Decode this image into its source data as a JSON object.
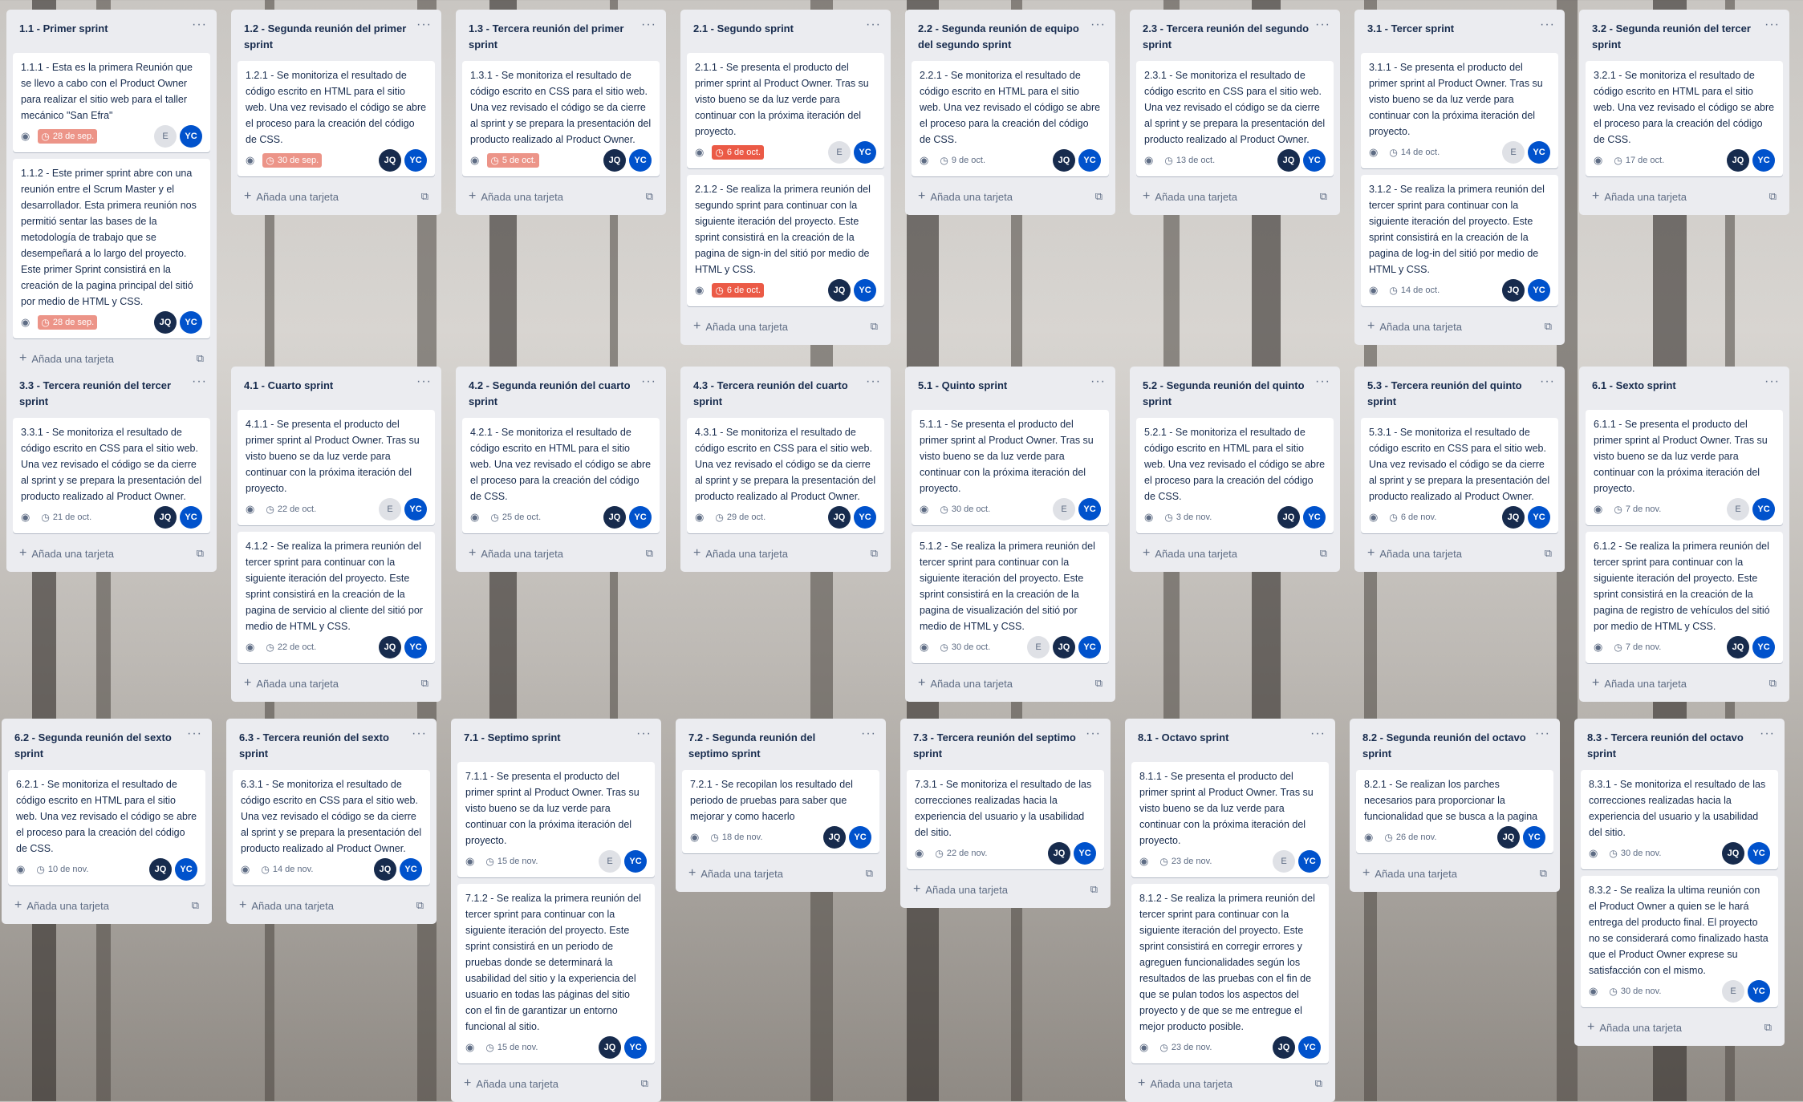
{
  "lists": [
    {
      "title": "1.1 - Primer sprint",
      "cards": [
        {
          "text": "1.1.1 - Esta es la primera Reunión que se llevo a cabo con el Product Owner para realizar el sitio web para el taller mecánico \"San Efra\"",
          "due": "28 de sep.",
          "due_status": "overdue-light",
          "members": [
            "E",
            "YC"
          ]
        },
        {
          "text": "1.1.2 - Este primer sprint abre con una reunión entre el Scrum Master y el desarrollador. Esta primera reunión nos permitió sentar las bases de la metodología de trabajo que se desempeñará a lo largo del proyecto. Este primer Sprint consistirá en la creación de la pagina principal del sitió por medio de HTML y CSS.",
          "due": "28 de sep.",
          "due_status": "overdue-light",
          "members": [
            "JQ",
            "YC"
          ]
        }
      ]
    },
    {
      "title": "1.2 - Segunda reunión del primer sprint",
      "cards": [
        {
          "text": "1.2.1 - Se monitoriza el resultado de código escrito en HTML para el sitio web. Una vez revisado el código se abre el proceso para la creación del código de CSS.",
          "due": "30 de sep.",
          "due_status": "overdue-light",
          "members": [
            "JQ",
            "YC"
          ]
        }
      ]
    },
    {
      "title": "1.3 - Tercera reunión del primer sprint",
      "cards": [
        {
          "text": "1.3.1 - Se monitoriza el resultado de código escrito en CSS para el sitio web. Una vez revisado el código se da cierre al sprint y se prepara la presentación del producto realizado al Product Owner.",
          "due": "5 de oct.",
          "due_status": "overdue-light",
          "members": [
            "JQ",
            "YC"
          ]
        }
      ]
    },
    {
      "title": "2.1 - Segundo sprint",
      "cards": [
        {
          "text": "2.1.1 - Se presenta el producto del primer sprint al Product Owner. Tras su visto bueno se da luz verde para continuar con la próxima iteración del proyecto.",
          "due": "6 de oct.",
          "due_status": "overdue",
          "members": [
            "E",
            "YC"
          ]
        },
        {
          "text": "2.1.2 - Se realiza la primera reunión del segundo sprint para continuar con la siguiente iteración del proyecto. Este sprint consistirá en la creación de la pagina de sign-in del sitió por medio de HTML y CSS.",
          "due": "6 de oct.",
          "due_status": "overdue",
          "members": [
            "JQ",
            "YC"
          ]
        }
      ]
    },
    {
      "title": "2.2 - Segunda reunión de equipo del segundo sprint",
      "cards": [
        {
          "text": "2.2.1 - Se monitoriza el resultado de código escrito en HTML para el sitio web. Una vez revisado el código se abre el proceso para la creación del código de CSS.",
          "due": "9 de oct.",
          "due_status": "",
          "members": [
            "JQ",
            "YC"
          ]
        }
      ]
    },
    {
      "title": "2.3 - Tercera reunión del segundo sprint",
      "cards": [
        {
          "text": "2.3.1 - Se monitoriza el resultado de código escrito en CSS para el sitio web. Una vez revisado el código se da cierre al sprint y se prepara la presentación del producto realizado al Product Owner.",
          "due": "13 de oct.",
          "due_status": "",
          "members": [
            "JQ",
            "YC"
          ]
        }
      ]
    },
    {
      "title": "3.1 - Tercer sprint",
      "cards": [
        {
          "text": "3.1.1 - Se presenta el producto del primer sprint al Product Owner. Tras su visto bueno se da luz verde para continuar con la próxima iteración del proyecto.",
          "due": "14 de oct.",
          "due_status": "",
          "members": [
            "E",
            "YC"
          ]
        },
        {
          "text": "3.1.2 - Se realiza la primera reunión del tercer sprint para continuar con la siguiente iteración del proyecto. Este sprint consistirá en la creación de la pagina de log-in del sitió por medio de HTML y CSS.",
          "due": "14 de oct.",
          "due_status": "",
          "members": [
            "JQ",
            "YC"
          ]
        }
      ]
    },
    {
      "title": "3.2 - Segunda reunión del tercer sprint",
      "cards": [
        {
          "text": "3.2.1 - Se monitoriza el resultado de código escrito en HTML para el sitio web. Una vez revisado el código se abre el proceso para la creación del código de CSS.",
          "due": "17 de oct.",
          "due_status": "",
          "members": [
            "JQ",
            "YC"
          ]
        }
      ]
    },
    {
      "title": "3.3 - Tercera reunión del tercer sprint",
      "cards": [
        {
          "text": "3.3.1 - Se monitoriza el resultado de código escrito en CSS para el sitio web. Una vez revisado el código se da cierre al sprint y se prepara la presentación del producto realizado al Product Owner.",
          "due": "21 de oct.",
          "due_status": "",
          "members": [
            "JQ",
            "YC"
          ]
        }
      ]
    },
    {
      "title": "4.1 - Cuarto sprint",
      "cards": [
        {
          "text": "4.1.1 - Se presenta el producto del primer sprint al Product Owner. Tras su visto bueno se da luz verde para continuar con la próxima iteración del proyecto.",
          "due": "22 de oct.",
          "due_status": "",
          "members": [
            "E",
            "YC"
          ]
        },
        {
          "text": "4.1.2 - Se realiza la primera reunión del tercer sprint para continuar con la siguiente iteración del proyecto. Este sprint consistirá en la creación de la pagina de servicio al cliente del sitió por medio de HTML y CSS.",
          "due": "22 de oct.",
          "due_status": "",
          "members": [
            "JQ",
            "YC"
          ]
        }
      ]
    },
    {
      "title": "4.2 - Segunda reunión del cuarto sprint",
      "cards": [
        {
          "text": "4.2.1 - Se monitoriza el resultado de código escrito en HTML para el sitio web. Una vez revisado el código se abre el proceso para la creación del código de CSS.",
          "due": "25 de oct.",
          "due_status": "",
          "members": [
            "JQ",
            "YC"
          ]
        }
      ]
    },
    {
      "title": "4.3 - Tercera reunión del cuarto sprint",
      "cards": [
        {
          "text": "4.3.1 - Se monitoriza el resultado de código escrito en CSS para el sitio web. Una vez revisado el código se da cierre al sprint y se prepara la presentación del producto realizado al Product Owner.",
          "due": "29 de oct.",
          "due_status": "",
          "members": [
            "JQ",
            "YC"
          ]
        }
      ]
    },
    {
      "title": "5.1 - Quinto sprint",
      "cards": [
        {
          "text": "5.1.1 - Se presenta el producto del primer sprint al Product Owner. Tras su visto bueno se da luz verde para continuar con la próxima iteración del proyecto.",
          "due": "30 de oct.",
          "due_status": "",
          "members": [
            "E",
            "YC"
          ]
        },
        {
          "text": "5.1.2 - Se realiza la primera reunión del tercer sprint para continuar con la siguiente iteración del proyecto. Este sprint consistirá en la creación de la pagina de visualización del sitió por medio de HTML y CSS.",
          "due": "30 de oct.",
          "due_status": "",
          "members": [
            "E",
            "JQ",
            "YC"
          ]
        }
      ]
    },
    {
      "title": "5.2 - Segunda reunión del quinto sprint",
      "cards": [
        {
          "text": "5.2.1 - Se monitoriza el resultado de código escrito en HTML para el sitio web. Una vez revisado el código se abre el proceso para la creación del código de CSS.",
          "due": "3 de nov.",
          "due_status": "",
          "members": [
            "JQ",
            "YC"
          ]
        }
      ]
    },
    {
      "title": "5.3 - Tercera reunión del quinto sprint",
      "cards": [
        {
          "text": "5.3.1 - Se monitoriza el resultado de código escrito en CSS para el sitio web. Una vez revisado el código se da cierre al sprint y se prepara la presentación del producto realizado al Product Owner.",
          "due": "6 de nov.",
          "due_status": "",
          "members": [
            "JQ",
            "YC"
          ]
        }
      ]
    },
    {
      "title": "6.1 - Sexto sprint",
      "cards": [
        {
          "text": "6.1.1 - Se presenta el producto del primer sprint al Product Owner. Tras su visto bueno se da luz verde para continuar con la próxima iteración del proyecto.",
          "due": "7 de nov.",
          "due_status": "",
          "members": [
            "E",
            "YC"
          ]
        },
        {
          "text": "6.1.2 - Se realiza la primera reunión del tercer sprint para continuar con la siguiente iteración del proyecto. Este sprint consistirá en la creación de la pagina de registro de vehículos del sitió por medio de HTML y CSS.",
          "due": "7 de nov.",
          "due_status": "",
          "members": [
            "JQ",
            "YC"
          ]
        }
      ]
    },
    {
      "title": "6.2 - Segunda reunión del sexto sprint",
      "cards": [
        {
          "text": "6.2.1 - Se monitoriza el resultado de código escrito en HTML para el sitio web. Una vez revisado el código se abre el proceso para la creación del código de CSS.",
          "due": "10 de nov.",
          "due_status": "",
          "members": [
            "JQ",
            "YC"
          ]
        }
      ]
    },
    {
      "title": "6.3 - Tercera reunión del sexto sprint",
      "cards": [
        {
          "text": "6.3.1 - Se monitoriza el resultado de código escrito en CSS para el sitio web. Una vez revisado el código se da cierre al sprint y se prepara la presentación del producto realizado al Product Owner.",
          "due": "14 de nov.",
          "due_status": "",
          "members": [
            "JQ",
            "YC"
          ]
        }
      ]
    },
    {
      "title": "7.1 - Septimo sprint",
      "cards": [
        {
          "text": "7.1.1 - Se presenta el producto del primer sprint al Product Owner. Tras su visto bueno se da luz verde para continuar con la próxima iteración del proyecto.",
          "due": "15 de nov.",
          "due_status": "",
          "members": [
            "E",
            "YC"
          ]
        },
        {
          "text": "7.1.2 - Se realiza la primera reunión del tercer sprint para continuar con la siguiente iteración del proyecto. Este sprint consistirá en un periodo de pruebas donde se determinará la usabilidad del sitio y la experiencia del usuario en todas las páginas del sitio con el fin de garantizar un entorno funcional al sitio.",
          "due": "15 de nov.",
          "due_status": "",
          "members": [
            "JQ",
            "YC"
          ]
        }
      ]
    },
    {
      "title": "7.2 - Segunda reunión del septimo sprint",
      "cards": [
        {
          "text": "7.2.1 - Se recopilan los resultado del periodo de pruebas para saber que mejorar y como hacerlo",
          "due": "18 de nov.",
          "due_status": "",
          "members": [
            "JQ",
            "YC"
          ]
        }
      ]
    },
    {
      "title": "7.3 - Tercera reunión del septimo sprint",
      "cards": [
        {
          "text": "7.3.1 - Se monitoriza el resultado de las correcciones realizadas hacia la experiencia del usuario y la usabilidad del sitio.",
          "due": "22 de nov.",
          "due_status": "",
          "members": [
            "JQ",
            "YC"
          ]
        }
      ]
    },
    {
      "title": "8.1 - Octavo sprint",
      "cards": [
        {
          "text": "8.1.1 - Se presenta el producto del primer sprint al Product Owner. Tras su visto bueno se da luz verde para continuar con la próxima iteración del proyecto.",
          "due": "23 de nov.",
          "due_status": "",
          "members": [
            "E",
            "YC"
          ]
        },
        {
          "text": "8.1.2 - Se realiza la primera reunión del tercer sprint para continuar con la siguiente iteración del proyecto. Este sprint consistirá en corregir errores y agreguen funcionalidades según los resultados de las pruebas con el fin de que se pulan todos los aspectos del proyecto y de que se me entregue el mejor producto posible.",
          "due": "23 de nov.",
          "due_status": "",
          "members": [
            "JQ",
            "YC"
          ]
        }
      ]
    },
    {
      "title": "8.2 - Segunda reunión del octavo sprint",
      "cards": [
        {
          "text": "8.2.1 - Se realizan los parches necesarios para proporcionar la funcionalidad que se busca a la pagina",
          "due": "26 de nov.",
          "due_status": "",
          "members": [
            "JQ",
            "YC"
          ]
        }
      ]
    },
    {
      "title": "8.3 - Tercera reunión del octavo sprint",
      "cards": [
        {
          "text": "8.3.1 - Se monitoriza el resultado de las correcciones realizadas hacia la experiencia del usuario y la usabilidad del sitio.",
          "due": "30 de nov.",
          "due_status": "",
          "members": [
            "JQ",
            "YC"
          ]
        },
        {
          "text": "8.3.2 - Se realiza la ultima reunión con el Product Owner a quien se le hará entrega del producto final. El proyecto no se considerará como finalizado hasta que el Product Owner exprese su satisfacción con el mismo.",
          "due": "30 de nov.",
          "due_status": "",
          "members": [
            "E",
            "YC"
          ]
        }
      ]
    }
  ],
  "add_card_label": "Añada una tarjeta",
  "list_menu_glyph": "···",
  "colors": {
    "list_bg": "#ebecf0",
    "overdue": "#eb5a46",
    "overdue_light": "#ec9488",
    "avatar_jq": "#172b4d",
    "avatar_yc": "#0052cc"
  }
}
